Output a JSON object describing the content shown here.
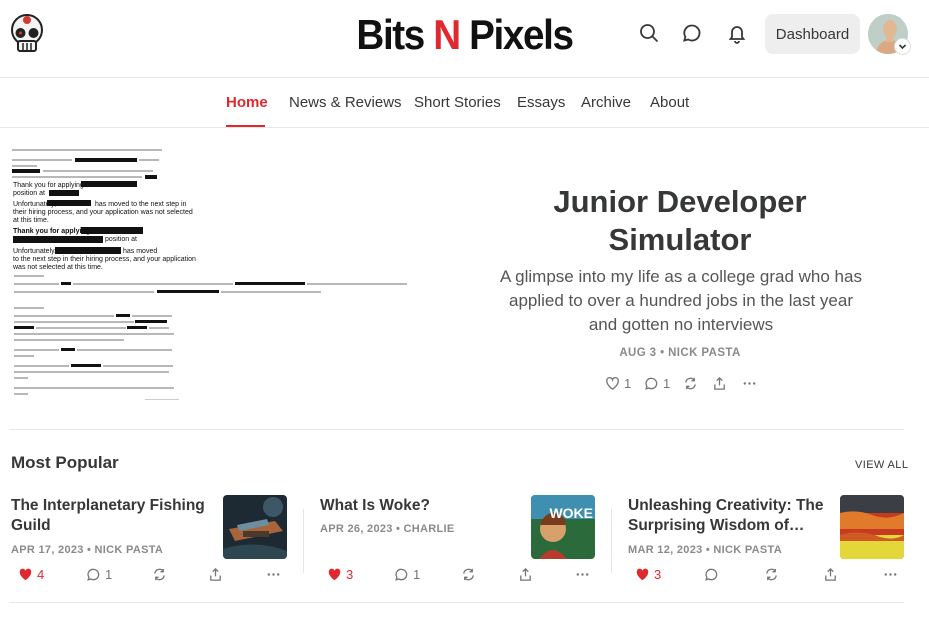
{
  "header": {
    "brand_part1": "Bits ",
    "brand_part2": "N",
    "brand_part3": " Pixels",
    "dashboard_label": "Dashboard",
    "icons": [
      "skull-logo-icon",
      "search-icon",
      "chat-icon",
      "bell-icon",
      "avatar",
      "chevron-down-icon"
    ]
  },
  "nav": {
    "items": [
      "Home",
      "News & Reviews",
      "Short Stories",
      "Essays",
      "Archive",
      "About"
    ],
    "active": "Home"
  },
  "hero": {
    "title": "Junior Developer Simulator",
    "subtitle": "A glimpse into my life as a college grad who has applied to over a hundred jobs in the last year and gotten no interviews",
    "meta": "AUG 3 • NICK PASTA",
    "likes": "1",
    "comments": "1",
    "image_lines": [
      "Thank you for applying to the",
      "position at",
      "Unfortunately,",
      "has moved to the next step in",
      "their hiring process, and your application was not selected",
      "at this time.",
      "Thank you for applying to the",
      "position at",
      "Unfortunately,",
      "has moved",
      "to the next step in their hiring process, and your application",
      "was not selected at this time."
    ]
  },
  "popular": {
    "title": "Most Popular",
    "view_all": "VIEW ALL",
    "posts": [
      {
        "title": "The Interplanetary Fishing Guild",
        "meta": "APR 17, 2023 • NICK PASTA",
        "likes": "4",
        "comments": "1"
      },
      {
        "title": "What Is Woke?",
        "meta": "APR 26, 2023 • CHARLIE",
        "likes": "3",
        "comments": "1",
        "thumb_text": "WOKE"
      },
      {
        "title": "Unleashing Creativity: The Surprising Wisdom of…",
        "meta": "MAR 12, 2023 • NICK PASTA",
        "likes": "3",
        "comments": ""
      }
    ]
  },
  "colors": {
    "accent": "#e0282f",
    "text": "#363737",
    "muted": "#8a8a8a",
    "border": "#e6e6e6",
    "button_bg": "#eeeeee"
  }
}
